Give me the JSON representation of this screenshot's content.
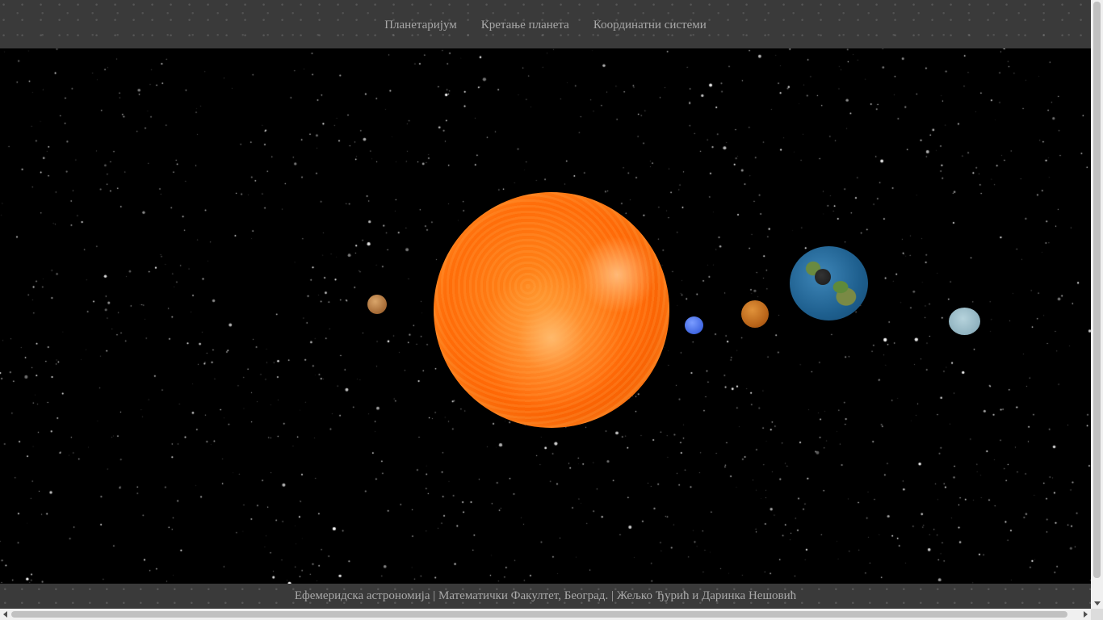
{
  "nav": {
    "items": [
      {
        "label": "Планетаријум"
      },
      {
        "label": "Кретање планета"
      },
      {
        "label": "Координатни системи"
      }
    ]
  },
  "scene": {
    "background": "#000000",
    "bodies": [
      "sun",
      "mercury",
      "neptune",
      "venus",
      "earth",
      "moon",
      "uranus"
    ]
  },
  "footer": {
    "text": "Ефемеридска астрономија | Математички Факултет, Београд. | Жељко Ђурић и Даринка Нешовић"
  }
}
